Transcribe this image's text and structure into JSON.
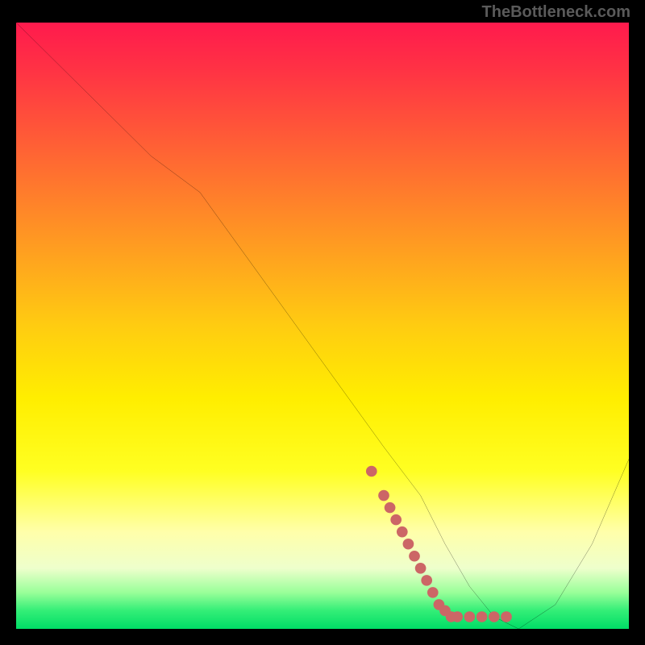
{
  "watermark": "TheBottleneck.com",
  "chart_data": {
    "type": "line",
    "title": "",
    "xlabel": "",
    "ylabel": "",
    "xlim": [
      0,
      100
    ],
    "ylim": [
      0,
      100
    ],
    "series": [
      {
        "name": "bottleneck-curve",
        "x": [
          0,
          8,
          15,
          22,
          30,
          40,
          50,
          60,
          66,
          70,
          74,
          78,
          82,
          88,
          94,
          100
        ],
        "y": [
          100,
          92,
          85,
          78,
          72,
          58,
          44,
          30,
          22,
          14,
          7,
          2,
          0,
          4,
          14,
          28
        ]
      }
    ],
    "markers": {
      "name": "highlight-dots",
      "color": "#cc6666",
      "points": [
        {
          "x": 58,
          "y": 26
        },
        {
          "x": 60,
          "y": 22
        },
        {
          "x": 61,
          "y": 20
        },
        {
          "x": 62,
          "y": 18
        },
        {
          "x": 63,
          "y": 16
        },
        {
          "x": 64,
          "y": 14
        },
        {
          "x": 65,
          "y": 12
        },
        {
          "x": 66,
          "y": 10
        },
        {
          "x": 67,
          "y": 8
        },
        {
          "x": 68,
          "y": 6
        },
        {
          "x": 69,
          "y": 4
        },
        {
          "x": 70,
          "y": 3
        },
        {
          "x": 71,
          "y": 2
        },
        {
          "x": 72,
          "y": 2
        },
        {
          "x": 74,
          "y": 2
        },
        {
          "x": 76,
          "y": 2
        },
        {
          "x": 78,
          "y": 2
        },
        {
          "x": 80,
          "y": 2
        }
      ]
    },
    "gradient_stops": [
      {
        "pos": 0,
        "color": "#ff1a4d"
      },
      {
        "pos": 50,
        "color": "#ffee00"
      },
      {
        "pos": 100,
        "color": "#00dd66"
      }
    ]
  }
}
